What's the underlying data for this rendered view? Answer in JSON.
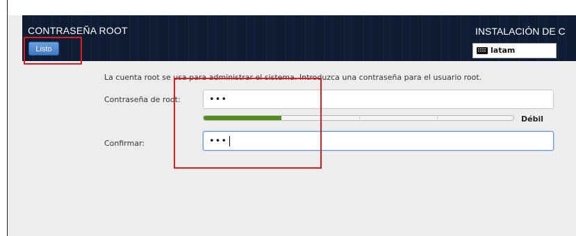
{
  "header": {
    "title": "CONTRASEÑA ROOT",
    "installer_title": "INSTALACIÓN DE C",
    "done_label": "Listo",
    "keyboard_layout": "latam",
    "keyboard_icon": "keyboard-icon"
  },
  "form": {
    "description": "La cuenta root se usa para administrar el sistema. Introduzca una contraseña para el usuario root.",
    "password_label": "Contraseña de root:",
    "password_value": "•••",
    "confirm_label": "Confirmar:",
    "confirm_value": "•••",
    "strength_label": "Débil",
    "strength_level": 0.25
  },
  "colors": {
    "header_bg": "#0d1c33",
    "button_blue": "#3f78c6",
    "meter_green": "#4f8f1c",
    "annotation_red": "#e01b1b"
  }
}
